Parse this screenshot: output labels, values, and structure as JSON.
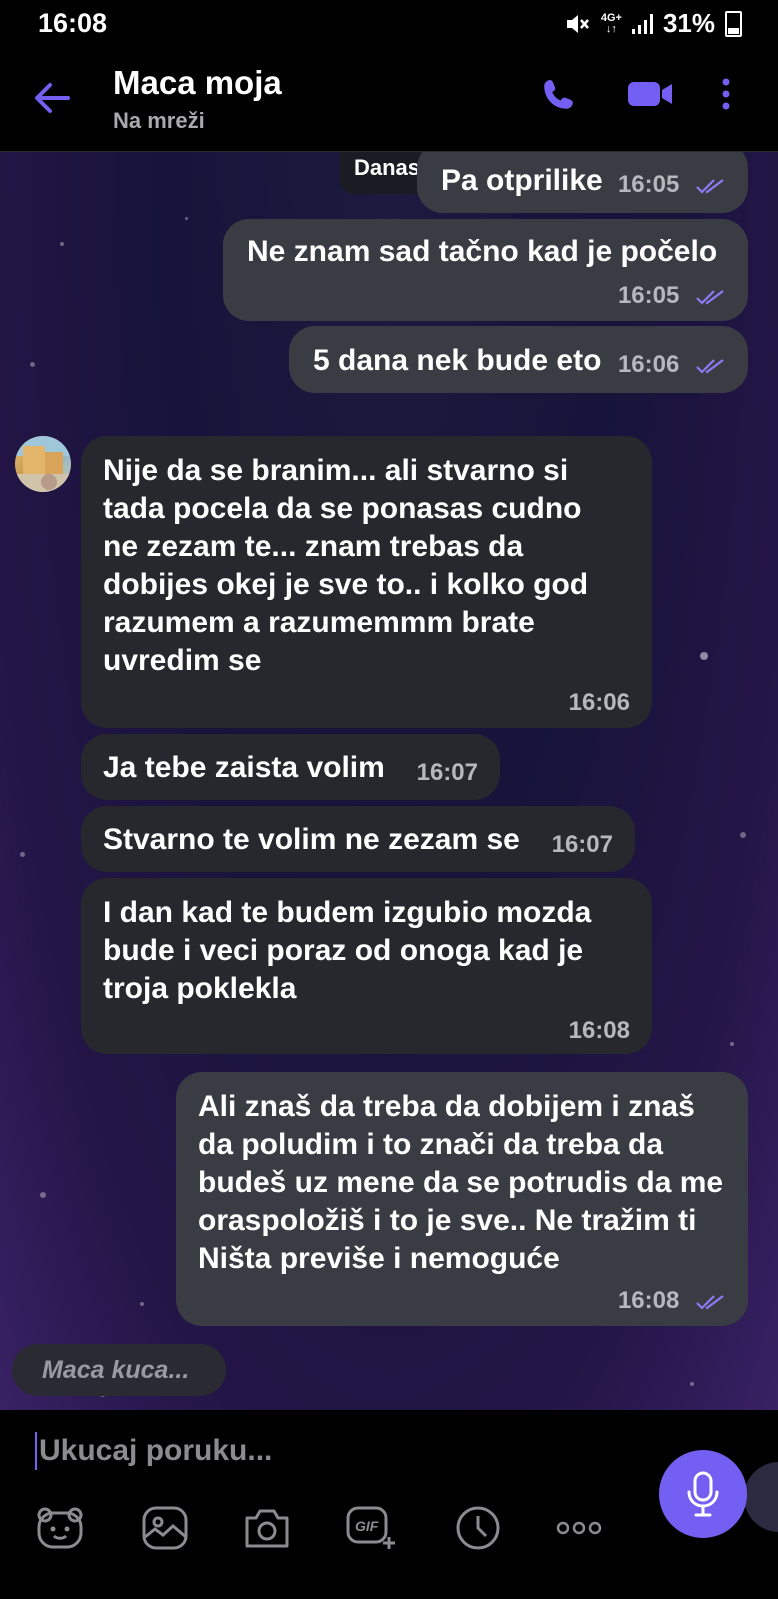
{
  "status": {
    "time": "16:08",
    "network": "4G+",
    "battery": "31%"
  },
  "header": {
    "contact_name": "Maca moja",
    "presence": "Na mreži"
  },
  "chat": {
    "date_divider": "Danas",
    "messages": [
      {
        "dir": "out",
        "text": "Pa otprilike",
        "time": "16:05"
      },
      {
        "dir": "out",
        "text": "Ne znam sad tačno kad je počelo",
        "time": "16:05"
      },
      {
        "dir": "out",
        "text": "5 dana nek bude eto",
        "time": "16:06"
      },
      {
        "dir": "in",
        "text": "Nije da se branim... ali stvarno si tada pocela da se ponasas cudno ne zezam te... znam trebas da dobijes okej je sve to.. i kolko god razumem a razumemmm brate uvredim se",
        "time": "16:06"
      },
      {
        "dir": "in",
        "text": "Ja tebe zaista volim",
        "time": "16:07"
      },
      {
        "dir": "in",
        "text": "Stvarno te volim ne zezam se",
        "time": "16:07"
      },
      {
        "dir": "in",
        "text": "I dan kad te budem izgubio mozda bude i veci poraz od onoga kad je troja poklekla",
        "time": "16:08"
      },
      {
        "dir": "out",
        "text": "Ali znaš da treba da dobijem i znaš da poludim i to znači da treba da budeš uz mene da se potrudis da me oraspoložiš i to je sve.. Ne tražim ti Ništa previše i nemoguće",
        "time": "16:08"
      }
    ],
    "typing_indicator": "Maca kuca..."
  },
  "composer": {
    "placeholder": "Ukucaj poruku...",
    "tools": [
      "sticker-icon",
      "image-icon",
      "camera-icon",
      "gif-icon",
      "clock-icon",
      "more-icon"
    ]
  },
  "colors": {
    "accent": "#7360f2",
    "outgoing_bubble": "#3a3c44",
    "incoming_bubble": "#26282e"
  }
}
